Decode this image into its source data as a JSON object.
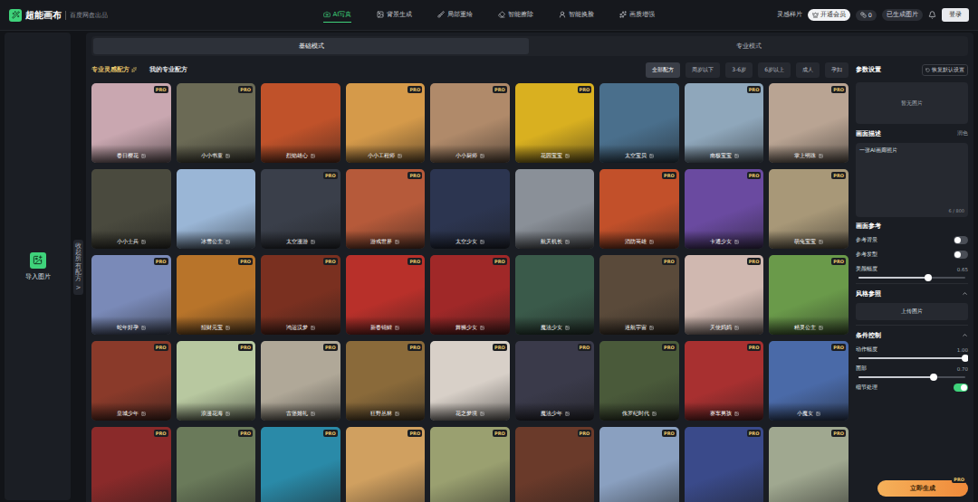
{
  "app": {
    "logo": "超能画布",
    "subtitle": "百度网盘出品"
  },
  "nav": [
    {
      "label": "AI写真",
      "selected": true
    },
    {
      "label": "背景生成",
      "selected": false
    },
    {
      "label": "局部重绘",
      "selected": false
    },
    {
      "label": "智能擦除",
      "selected": false
    },
    {
      "label": "智能换脸",
      "selected": false
    },
    {
      "label": "画质增强",
      "selected": false
    }
  ],
  "header_right": {
    "inspiration": "灵感样片",
    "vip": "开通会员",
    "coins": "0",
    "generated": "已生成图片",
    "login": "登录"
  },
  "sidebar": {
    "import": "导入图片",
    "collapse": "收起所有配方",
    "collapse_arrow": ">"
  },
  "modes": [
    {
      "label": "基础模式",
      "selected": true
    },
    {
      "label": "专业模式",
      "selected": false
    }
  ],
  "recipe_tabs": [
    {
      "label": "专业灵感配方",
      "selected": true
    },
    {
      "label": "我的专业配方",
      "selected": false
    }
  ],
  "filters": [
    {
      "label": "全部配方",
      "selected": true
    },
    {
      "label": "周岁以下",
      "selected": false
    },
    {
      "label": "3-6岁",
      "selected": false
    },
    {
      "label": "6岁以上",
      "selected": false
    },
    {
      "label": "成人",
      "selected": false
    },
    {
      "label": "孕妇",
      "selected": false
    }
  ],
  "pro_label": "PRO",
  "cards": [
    {
      "label": "春日樱花",
      "pro": true,
      "color": "#c9a7b0"
    },
    {
      "label": "小小书童",
      "pro": true,
      "color": "#6b6a55"
    },
    {
      "label": "烈焰雄心",
      "pro": false,
      "color": "#c0522a"
    },
    {
      "label": "小小工程师",
      "pro": true,
      "color": "#d59a4a"
    },
    {
      "label": "小小厨师",
      "pro": true,
      "color": "#b08a6a"
    },
    {
      "label": "花园宝宝",
      "pro": true,
      "color": "#d9b020"
    },
    {
      "label": "太空宝贝",
      "pro": false,
      "color": "#4a6f8c"
    },
    {
      "label": "南极宝宝",
      "pro": true,
      "color": "#8fa7bb"
    },
    {
      "label": "掌上明珠",
      "pro": true,
      "color": "#b9a493"
    },
    {
      "label": "小小士兵",
      "pro": false,
      "color": "#4a4a3e"
    },
    {
      "label": "冰雪公主",
      "pro": false,
      "color": "#9ab6d6"
    },
    {
      "label": "太空漫游",
      "pro": true,
      "color": "#3a3f4a"
    },
    {
      "label": "游戏世界",
      "pro": true,
      "color": "#b65a3a"
    },
    {
      "label": "太空少女",
      "pro": false,
      "color": "#2c3550"
    },
    {
      "label": "航天机长",
      "pro": false,
      "color": "#8a9098"
    },
    {
      "label": "消防英雄",
      "pro": true,
      "color": "#c2502a"
    },
    {
      "label": "卡通少女",
      "pro": true,
      "color": "#6a4aa0"
    },
    {
      "label": "萌兔宝宝",
      "pro": true,
      "color": "#a89878"
    },
    {
      "label": "蛇年好孕",
      "pro": true,
      "color": "#7a8ab8"
    },
    {
      "label": "招财元宝",
      "pro": true,
      "color": "#b8742a"
    },
    {
      "label": "鸿运汉梦",
      "pro": true,
      "color": "#7a3020"
    },
    {
      "label": "新春锦鲤",
      "pro": true,
      "color": "#b8302a"
    },
    {
      "label": "舞狮少女",
      "pro": true,
      "color": "#a02828"
    },
    {
      "label": "魔法少女",
      "pro": false,
      "color": "#3a5a4a"
    },
    {
      "label": "迷航宇宙",
      "pro": true,
      "color": "#5a4a3a"
    },
    {
      "label": "天使妈妈",
      "pro": true,
      "color": "#d0b8b0"
    },
    {
      "label": "精灵公主",
      "pro": true,
      "color": "#6a9a4a"
    },
    {
      "label": "皇城少年",
      "pro": true,
      "color": "#8a3a2a"
    },
    {
      "label": "浪漫花海",
      "pro": true,
      "color": "#b8c8a0"
    },
    {
      "label": "古堡婚礼",
      "pro": true,
      "color": "#b0a898"
    },
    {
      "label": "狂野丛林",
      "pro": true,
      "color": "#8a6a3a"
    },
    {
      "label": "花之梦境",
      "pro": true,
      "color": "#d8d0c8"
    },
    {
      "label": "魔法少年",
      "pro": true,
      "color": "#3a3a4a"
    },
    {
      "label": "侏罗纪时代",
      "pro": true,
      "color": "#4a5a3a"
    },
    {
      "label": "赛车男孩",
      "pro": true,
      "color": "#a83030"
    },
    {
      "label": "小魔女",
      "pro": true,
      "color": "#4a6aa8"
    },
    {
      "pro": true,
      "color": "#8a2a2a"
    },
    {
      "pro": true,
      "color": "#6a7a5a"
    },
    {
      "pro": true,
      "color": "#2a8aa8"
    },
    {
      "pro": true,
      "color": "#d0a060"
    },
    {
      "pro": true,
      "color": "#9aa070"
    },
    {
      "pro": true,
      "color": "#6a3a2a"
    },
    {
      "pro": true,
      "color": "#8aa0c0"
    },
    {
      "pro": true,
      "color": "#3a4a8a"
    },
    {
      "pro": true,
      "color": "#a0a890"
    }
  ],
  "params": {
    "title": "参数设置",
    "reset": "恢复默认设置",
    "preview": "暂无图片",
    "description": {
      "label": "画面描述",
      "polish": "润色",
      "value": "一张AI画廊照片",
      "count": "6 / 800"
    },
    "reference": {
      "label": "画面参考",
      "items": [
        {
          "kind": "toggle",
          "label": "参考背景",
          "on": false
        },
        {
          "kind": "toggle",
          "label": "参考发型",
          "on": false
        },
        {
          "kind": "slider",
          "label": "美颜幅度",
          "level": 0.65,
          "reading": "0.65"
        }
      ]
    },
    "style": {
      "label": "风格参照",
      "expanded": true,
      "button": "上传图片"
    },
    "control": {
      "label": "条件控制",
      "expanded": true,
      "items": [
        {
          "kind": "slider",
          "label": "动作幅度",
          "level": 1,
          "reading": "1.00"
        },
        {
          "kind": "slider",
          "label": "面部",
          "level": 0.7,
          "reading": "0.70"
        },
        {
          "kind": "toggle",
          "label": "细节处理",
          "on": true
        }
      ]
    },
    "generate": "立即生成"
  }
}
